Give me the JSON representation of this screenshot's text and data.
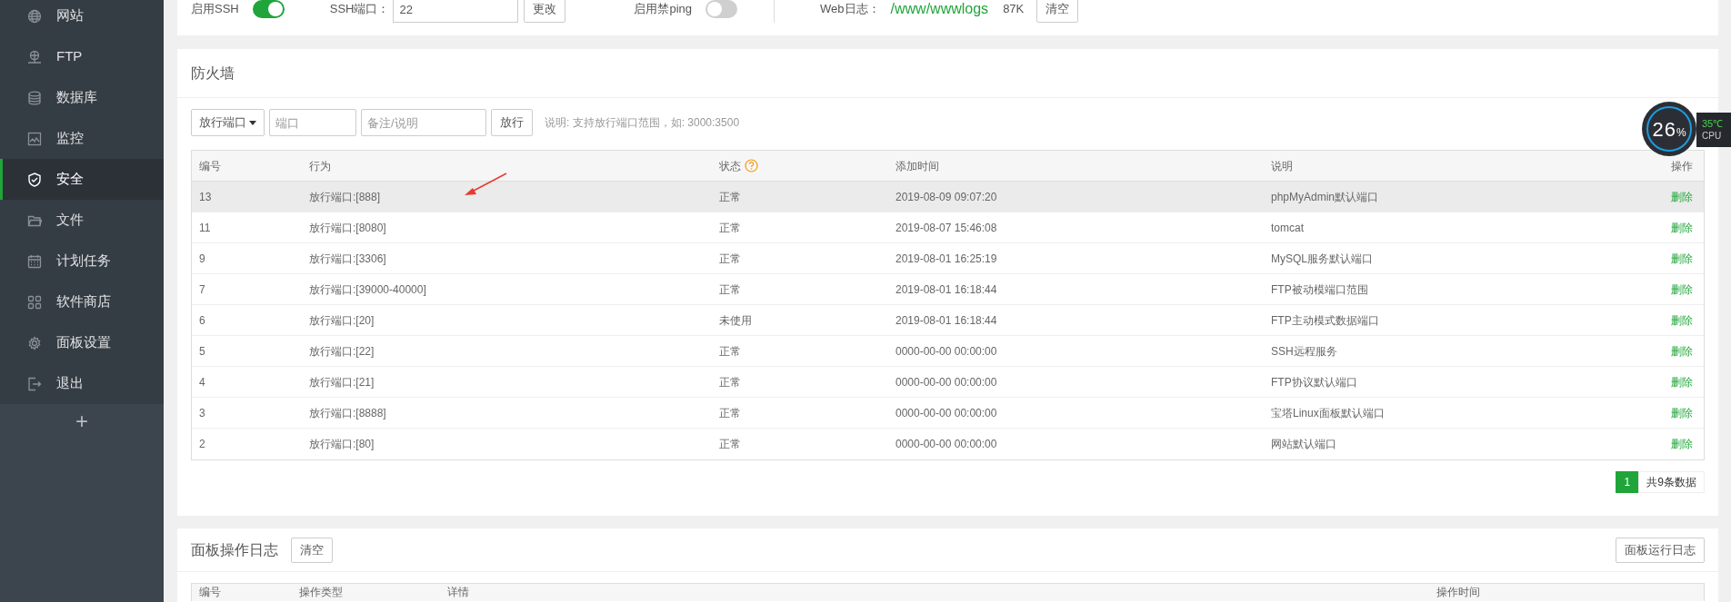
{
  "sidebar": {
    "items": [
      {
        "label": "网站",
        "selected": false
      },
      {
        "label": "FTP",
        "selected": false
      },
      {
        "label": "数据库",
        "selected": false
      },
      {
        "label": "监控",
        "selected": false
      },
      {
        "label": "安全",
        "selected": true
      },
      {
        "label": "文件",
        "selected": false
      },
      {
        "label": "计划任务",
        "selected": false
      },
      {
        "label": "软件商店",
        "selected": false
      },
      {
        "label": "面板设置",
        "selected": false
      },
      {
        "label": "退出",
        "selected": false
      }
    ],
    "add_button": "+"
  },
  "settings_bar": {
    "ssh_label": "启用SSH",
    "ssh_on": true,
    "port_label": "SSH端口：",
    "port_value": "22",
    "change_button": "更改",
    "ping_label": "启用禁ping",
    "ping_on": false,
    "weblog_label": "Web日志：",
    "weblog_path": "/www/wwwlogs",
    "weblog_size": "87K",
    "clear_button": "清空"
  },
  "firewall": {
    "title": "防火墙",
    "type_select": "放行端口",
    "port_placeholder": "端口",
    "note_placeholder": "备注/说明",
    "allow_button": "放行",
    "hint": "说明: 支持放行端口范围，如: 3000:3500",
    "columns": [
      "编号",
      "行为",
      "状态",
      "添加时间",
      "说明",
      "操作"
    ],
    "rows": [
      {
        "id": "13",
        "action": "放行端口:[888]",
        "status": "正常",
        "time": "2019-08-09 09:07:20",
        "note": "phpMyAdmin默认端口",
        "op": "删除",
        "selected": true
      },
      {
        "id": "11",
        "action": "放行端口:[8080]",
        "status": "正常",
        "time": "2019-08-07 15:46:08",
        "note": "tomcat",
        "op": "删除",
        "selected": false
      },
      {
        "id": "9",
        "action": "放行端口:[3306]",
        "status": "正常",
        "time": "2019-08-01 16:25:19",
        "note": "MySQL服务默认端口",
        "op": "删除",
        "selected": false
      },
      {
        "id": "7",
        "action": "放行端口:[39000-40000]",
        "status": "正常",
        "time": "2019-08-01 16:18:44",
        "note": "FTP被动模端口范围",
        "op": "删除",
        "selected": false
      },
      {
        "id": "6",
        "action": "放行端口:[20]",
        "status": "未使用",
        "time": "2019-08-01 16:18:44",
        "note": "FTP主动模式数据端口",
        "op": "删除",
        "selected": false
      },
      {
        "id": "5",
        "action": "放行端口:[22]",
        "status": "正常",
        "time": "0000-00-00 00:00:00",
        "note": "SSH远程服务",
        "op": "删除",
        "selected": false
      },
      {
        "id": "4",
        "action": "放行端口:[21]",
        "status": "正常",
        "time": "0000-00-00 00:00:00",
        "note": "FTP协议默认端口",
        "op": "删除",
        "selected": false
      },
      {
        "id": "3",
        "action": "放行端口:[8888]",
        "status": "正常",
        "time": "0000-00-00 00:00:00",
        "note": "宝塔Linux面板默认端口",
        "op": "删除",
        "selected": false
      },
      {
        "id": "2",
        "action": "放行端口:[80]",
        "status": "正常",
        "time": "0000-00-00 00:00:00",
        "note": "网站默认端口",
        "op": "删除",
        "selected": false
      }
    ],
    "pagination": {
      "page": "1",
      "total": "共9条数据"
    }
  },
  "panel_log": {
    "title": "面板操作日志",
    "clear_button": "清空",
    "run_log_button": "面板运行日志",
    "columns": [
      "编号",
      "操作类型",
      "详情",
      "操作时间"
    ]
  },
  "cpu_widget": {
    "value": "26",
    "unit": "%",
    "temperature": "35℃",
    "label": "CPU"
  }
}
